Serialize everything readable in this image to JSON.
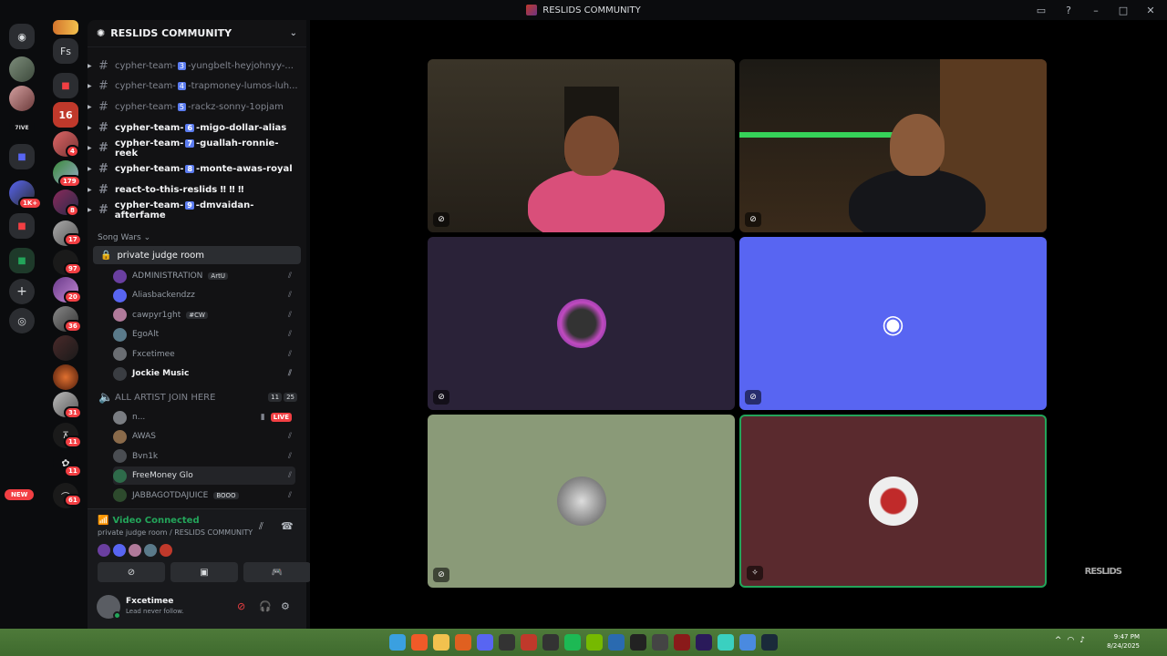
{
  "window": {
    "title": "RESLIDS COMMUNITY"
  },
  "server": {
    "name": "RESLIDS COMMUNITY"
  },
  "guilds": {
    "fs_label": "Fs",
    "new_label": "NEW",
    "badges": [
      "4",
      "179",
      "8",
      "17",
      "97",
      "20",
      "36",
      "31",
      "11",
      "11",
      "61",
      "1K+"
    ]
  },
  "channels": [
    {
      "name_prefix": "cypher-team-",
      "num": "3",
      "name_suffix": "-yungbelt-heyjohnyy-...",
      "unread": false
    },
    {
      "name_prefix": "cypher-team-",
      "num": "4",
      "name_suffix": "-trapmoney-lumos-luh...",
      "unread": false
    },
    {
      "name_prefix": "cypher-team-",
      "num": "5",
      "name_suffix": "-rackz-sonny-1opjam",
      "unread": false
    },
    {
      "name_prefix": "cypher-team-",
      "num": "6",
      "name_suffix": "-migo-dollar-alias",
      "unread": true
    },
    {
      "name_prefix": "cypher-team-",
      "num": "7",
      "name_suffix": "-guallah-ronnie-reek",
      "unread": true
    },
    {
      "name_prefix": "cypher-team-",
      "num": "8",
      "name_suffix": "-monte-awas-royal",
      "unread": true
    },
    {
      "name_prefix": "react-to-this-reslids",
      "num": "",
      "name_suffix": " ‼ ‼ ‼",
      "unread": true
    },
    {
      "name_prefix": "cypher-team-",
      "num": "9",
      "name_suffix": "-dmvaidan-afterfame",
      "unread": true
    }
  ],
  "category": {
    "name": "Song Wars"
  },
  "voice1": {
    "name": "private judge room",
    "users": [
      {
        "name": "ADMINISTRATION",
        "tag": "ArtU",
        "color": "#6a3fa0",
        "bold": false
      },
      {
        "name": "Aliasbackendzz",
        "tag": "",
        "color": "#5865f2",
        "bold": false
      },
      {
        "name": "cawpyr1ght",
        "tag": "#CW",
        "color": "#b07a9a",
        "bold": false
      },
      {
        "name": "EgoAlt",
        "tag": "",
        "color": "#5a7a8a",
        "bold": false
      },
      {
        "name": "Fxcetimee",
        "tag": "",
        "color": "#6a6d72",
        "bold": false
      },
      {
        "name": "Jockie Music",
        "tag": "",
        "color": "#3a3d42",
        "bold": true
      }
    ]
  },
  "voice2": {
    "name": "ALL ARTIST JOIN HERE",
    "count_a": "11",
    "count_b": "25",
    "users": [
      {
        "name": "n...",
        "tag": "",
        "color": "#7a7d82",
        "live": true
      },
      {
        "name": "AWAS",
        "tag": "",
        "color": "#8a6a4a",
        "live": false
      },
      {
        "name": "Bvn1k",
        "tag": "",
        "color": "#4a4d52",
        "live": false
      },
      {
        "name": "FreeMoney Glo",
        "tag": "",
        "color": "#2e6b4a",
        "live": false
      },
      {
        "name": "JABBAGOTDAJUICE",
        "tag": "BOOO",
        "color": "#2d4a2d",
        "live": false
      }
    ]
  },
  "live_label": "LIVE",
  "voice_status": {
    "title": "Video Connected",
    "subtitle": "private judge room / RESLIDS COMMUNITY"
  },
  "user": {
    "name": "Fxcetimee",
    "status": "Lead never follow."
  },
  "watermark": "RESLIDS",
  "clock": {
    "time": "9:47 PM",
    "date": "8/24/2025"
  },
  "colors": {
    "accent": "#5865f2",
    "green": "#23a55a",
    "red": "#f23f43"
  }
}
